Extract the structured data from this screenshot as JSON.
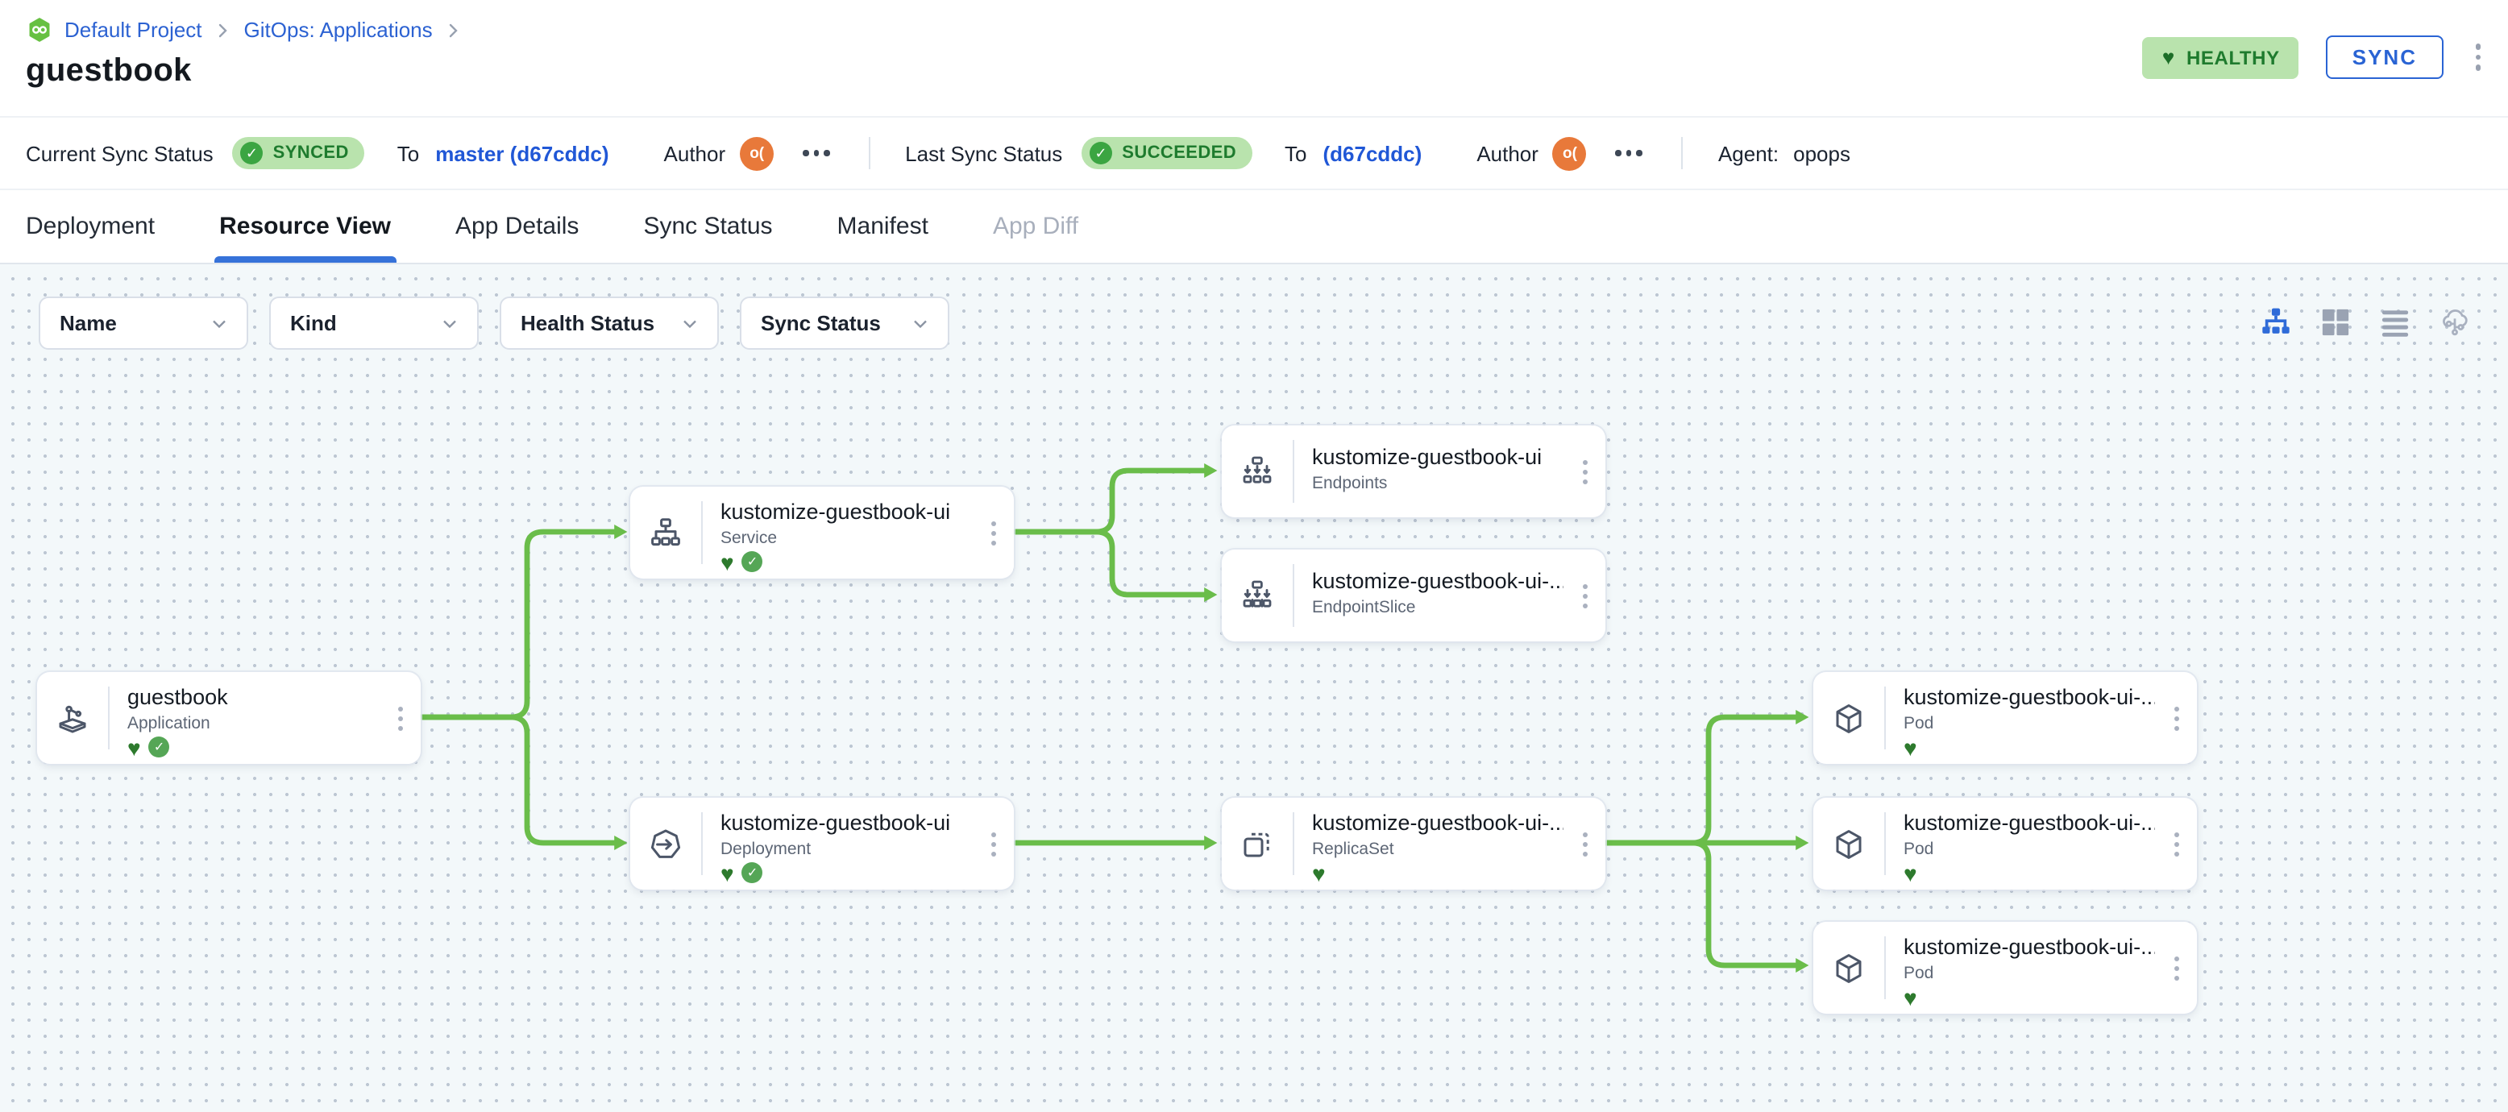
{
  "colors": {
    "accent_blue": "#2f6bd8",
    "link_blue": "#2c62d2",
    "edge_green": "#6abd4a",
    "badge_green_bg": "#b9e3ad",
    "badge_green_text": "#1e7b2e",
    "avatar_orange": "#e8793a",
    "canvas_bg": "#f3f8fa"
  },
  "header": {
    "breadcrumb": [
      "Default Project",
      "GitOps: Applications"
    ],
    "title": "guestbook",
    "health_badge": {
      "icon": "heart-icon",
      "label": "HEALTHY"
    },
    "sync_button": "SYNC",
    "more_icon": "kebab-menu-icon"
  },
  "status_bar": {
    "current": {
      "label": "Current Sync Status",
      "badge": "SYNCED",
      "to": "To",
      "target": "master (d67cddc)",
      "author": "Author",
      "avatar": "o(",
      "more_icon": "ellipsis-icon"
    },
    "last": {
      "label": "Last Sync Status",
      "badge": "SUCCEEDED",
      "to": "To",
      "target": "(d67cddc)",
      "author": "Author",
      "avatar": "o(",
      "more_icon": "ellipsis-icon"
    },
    "agent": {
      "label": "Agent:",
      "value": "opops"
    }
  },
  "tabs": [
    {
      "label": "Deployment",
      "state": "normal"
    },
    {
      "label": "Resource View",
      "state": "active"
    },
    {
      "label": "App Details",
      "state": "normal"
    },
    {
      "label": "Sync Status",
      "state": "normal"
    },
    {
      "label": "Manifest",
      "state": "normal"
    },
    {
      "label": "App Diff",
      "state": "disabled"
    }
  ],
  "filters": [
    {
      "label": "Name"
    },
    {
      "label": "Kind"
    },
    {
      "label": "Health Status"
    },
    {
      "label": "Sync Status"
    }
  ],
  "view_toggles": [
    {
      "icon": "tree-view-icon",
      "active": true
    },
    {
      "icon": "grid-view-icon",
      "active": false
    },
    {
      "icon": "list-view-icon",
      "active": false
    },
    {
      "icon": "cloud-view-icon",
      "active": false
    }
  ],
  "nodes": [
    {
      "title": "guestbook",
      "kind": "Application",
      "healthy": true,
      "synced": true,
      "icon": "application-icon"
    },
    {
      "title": "kustomize-guestbook-ui",
      "kind": "Service",
      "healthy": true,
      "synced": true,
      "icon": "service-icon"
    },
    {
      "title": "kustomize-guestbook-ui",
      "kind": "Endpoints",
      "healthy": false,
      "synced": false,
      "icon": "endpoints-icon"
    },
    {
      "title": "kustomize-guestbook-ui-...",
      "kind": "EndpointSlice",
      "healthy": false,
      "synced": false,
      "icon": "endpointslice-icon"
    },
    {
      "title": "kustomize-guestbook-ui",
      "kind": "Deployment",
      "healthy": true,
      "synced": true,
      "icon": "deployment-icon"
    },
    {
      "title": "kustomize-guestbook-ui-...",
      "kind": "ReplicaSet",
      "healthy": true,
      "synced": false,
      "icon": "replicaset-icon"
    },
    {
      "title": "kustomize-guestbook-ui-...",
      "kind": "Pod",
      "healthy": true,
      "synced": false,
      "icon": "pod-icon"
    },
    {
      "title": "kustomize-guestbook-ui-...",
      "kind": "Pod",
      "healthy": true,
      "synced": false,
      "icon": "pod-icon"
    },
    {
      "title": "kustomize-guestbook-ui-...",
      "kind": "Pod",
      "healthy": true,
      "synced": false,
      "icon": "pod-icon"
    }
  ]
}
